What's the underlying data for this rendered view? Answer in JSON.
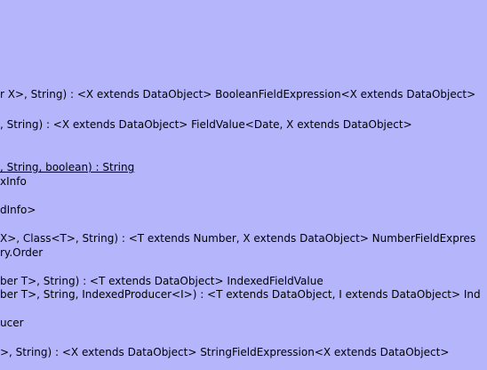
{
  "lines": [
    "r X>, String) : <X extends DataObject> BooleanFieldExpression<X extends DataObject>",
    ", String) : <X extends DataObject> FieldValue<Date, X extends DataObject>",
    ", String, boolean) : String",
    "xInfo",
    "dInfo>",
    " X>, Class<T>, String) : <T extends Number, X extends DataObject> NumberFieldExpres",
    "ry.Order",
    "ber T>, String) : <T extends DataObject> IndexedFieldValue",
    "ber T>, String, IndexedProducer<I>) : <T extends DataObject, I extends DataObject> Ind",
    "ucer",
    ">, String) : <X extends DataObject> StringFieldExpression<X extends DataObject>"
  ]
}
